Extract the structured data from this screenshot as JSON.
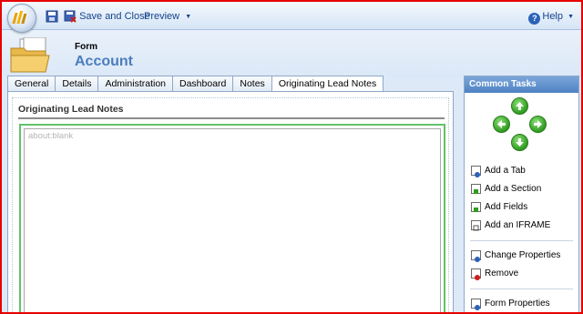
{
  "toolbar": {
    "save_and_close_label": "Save and Close",
    "preview_label": "Preview",
    "help_label": "Help"
  },
  "header": {
    "entity_type": "Form",
    "entity_name": "Account"
  },
  "tabs": [
    {
      "label": "General",
      "active": false
    },
    {
      "label": "Details",
      "active": false
    },
    {
      "label": "Administration",
      "active": false
    },
    {
      "label": "Dashboard",
      "active": false
    },
    {
      "label": "Notes",
      "active": false
    },
    {
      "label": "Originating Lead Notes",
      "active": true
    }
  ],
  "section": {
    "title": "Originating Lead Notes",
    "iframe_src": "about:blank"
  },
  "common_tasks": {
    "title": "Common Tasks",
    "items": [
      {
        "label": "Add a Tab",
        "icon": "add-tab-icon"
      },
      {
        "label": "Add a Section",
        "icon": "add-section-icon"
      },
      {
        "label": "Add Fields",
        "icon": "add-fields-icon"
      },
      {
        "label": "Add an IFRAME",
        "icon": "add-iframe-icon"
      },
      {
        "label": "Change Properties",
        "icon": "change-properties-icon"
      },
      {
        "label": "Remove",
        "icon": "remove-icon"
      },
      {
        "label": "Form Properties",
        "icon": "form-properties-icon"
      }
    ]
  },
  "colors": {
    "accent_blue": "#4a7dbd",
    "iframe_border_green": "#62c26a",
    "arrow_green": "#2e9c1f",
    "screenshot_border_red": "#e60000"
  }
}
